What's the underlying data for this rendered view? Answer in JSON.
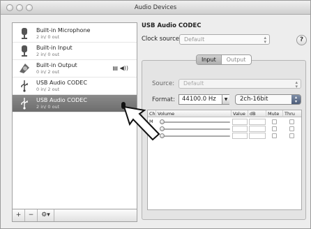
{
  "window": {
    "title": "Audio Devices"
  },
  "devices": [
    {
      "name": "Built-in Microphone",
      "io": "2 in/ 0 out",
      "icon": "microphone-icon",
      "selected": false
    },
    {
      "name": "Built-in Input",
      "io": "2 in/ 0 out",
      "icon": "microphone-icon",
      "selected": false
    },
    {
      "name": "Built-in Output",
      "io": "0 in/ 2 out",
      "icon": "speaker-icon",
      "selected": false,
      "row_icons": "▤ ◀))"
    },
    {
      "name": "USB Audio CODEC",
      "io": "0 in/ 2 out",
      "icon": "usb-icon",
      "selected": false
    },
    {
      "name": "USB Audio CODEC",
      "io": "2 in/ 0 out",
      "icon": "usb-icon",
      "selected": true
    }
  ],
  "sidebar_buttons": {
    "add": "+",
    "remove": "−",
    "gear": "⚙▾"
  },
  "detail": {
    "device_title": "USB Audio CODEC",
    "clock_label": "Clock source:",
    "clock_value": "Default",
    "help": "?"
  },
  "tabs": {
    "input": "Input",
    "output": "Output",
    "active": "Input"
  },
  "stream": {
    "source_label": "Source:",
    "source_value": "Default",
    "format_label": "Format:",
    "sample_rate": "44100.0 Hz",
    "channels_bits": "2ch-16bit"
  },
  "table": {
    "columns": [
      "Ch",
      "Volume",
      "Value",
      "dB",
      "Mute",
      "Thru"
    ],
    "rows": [
      {
        "ch": "M"
      },
      {
        "ch": ""
      },
      {
        "ch": ""
      }
    ]
  },
  "colors": {
    "selected_row": "#777777",
    "accent_button": "#5a6a86"
  }
}
